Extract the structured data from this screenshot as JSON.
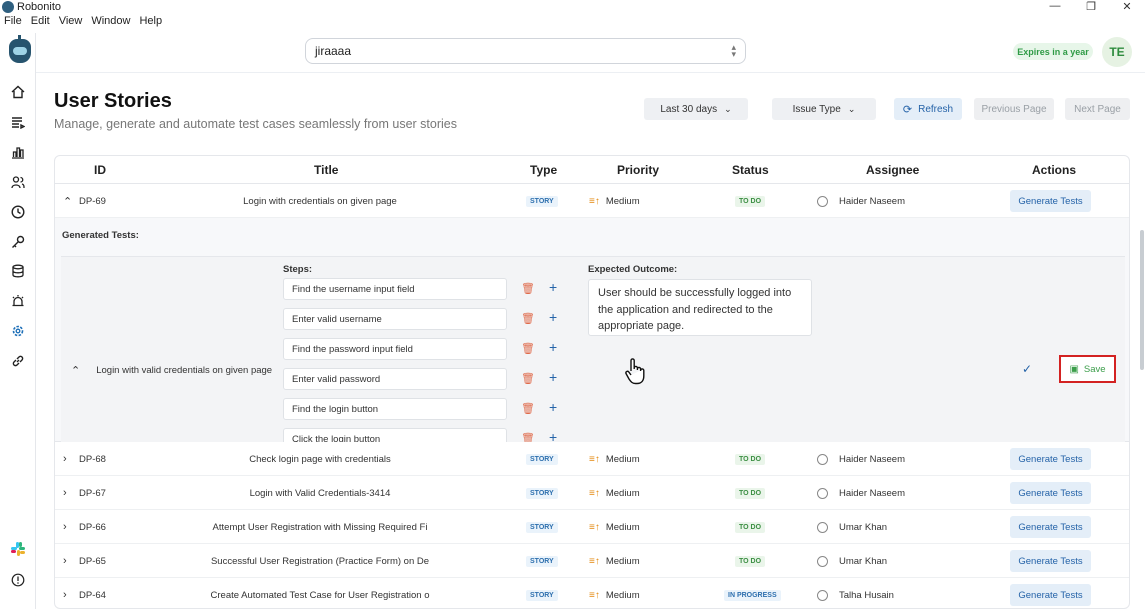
{
  "window": {
    "title": "Robonito",
    "minimize": "—",
    "maximize": "❐",
    "close": "✕"
  },
  "menu": [
    "File",
    "Edit",
    "View",
    "Window",
    "Help"
  ],
  "project_select": {
    "value": "jiraaaa"
  },
  "license_badge": "Expires in a year",
  "user_initials": "TE",
  "page": {
    "title": "User Stories",
    "subtitle": "Manage, generate and automate test cases seamlessly from user stories"
  },
  "toolbar": {
    "date_filter": "Last 30 days",
    "issue_type": "Issue Type",
    "refresh": "Refresh",
    "previous": "Previous Page",
    "next": "Next Page"
  },
  "table": {
    "headers": [
      "ID",
      "Title",
      "Type",
      "Priority",
      "Status",
      "Assignee",
      "Actions"
    ],
    "expanded": {
      "id": "DP-69",
      "title": "Login with credentials on given page",
      "type": "STORY",
      "priority": "Medium",
      "status": "TO DO",
      "assignee": "Haider Naseem",
      "action": "Generate Tests",
      "generated_label": "Generated Tests:",
      "test": {
        "title": "Login with valid credentials on given page",
        "steps_label": "Steps:",
        "steps": [
          "Find the username input field",
          "Enter valid username",
          "Find the password input field",
          "Enter valid password",
          "Find the login button",
          "Click the login button"
        ],
        "expected_label": "Expected Outcome:",
        "expected": "User should be successfully logged into the application and redirected to the appropriate page.",
        "save": "Save"
      }
    },
    "rows": [
      {
        "id": "DP-68",
        "title": "Check login page with credentials",
        "type": "STORY",
        "priority": "Medium",
        "status": "TO DO",
        "assignee": "Haider Naseem",
        "action": "Generate Tests"
      },
      {
        "id": "DP-67",
        "title": "Login with Valid Credentials-3414",
        "type": "STORY",
        "priority": "Medium",
        "status": "TO DO",
        "assignee": "Haider Naseem",
        "action": "Generate Tests"
      },
      {
        "id": "DP-66",
        "title": "Attempt User Registration with Missing Required Fi",
        "type": "STORY",
        "priority": "Medium",
        "status": "TO DO",
        "assignee": "Umar Khan",
        "action": "Generate Tests"
      },
      {
        "id": "DP-65",
        "title": "Successful User Registration (Practice Form) on De",
        "type": "STORY",
        "priority": "Medium",
        "status": "TO DO",
        "assignee": "Umar Khan",
        "action": "Generate Tests"
      },
      {
        "id": "DP-64",
        "title": "Create Automated Test Case for User Registration o",
        "type": "STORY",
        "priority": "Medium",
        "status": "IN PROGRESS",
        "assignee": "Talha Husain",
        "action": "Generate Tests"
      }
    ]
  }
}
